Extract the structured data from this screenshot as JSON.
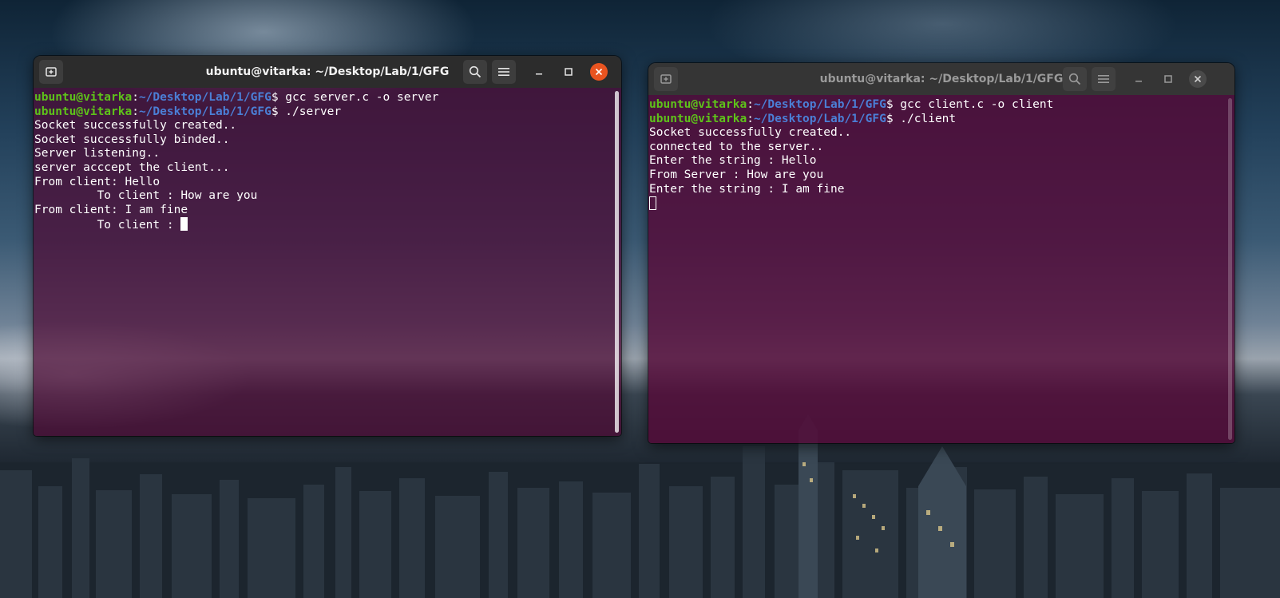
{
  "desktop": {
    "wallpaper": "night-city-skyline",
    "accent_close": "#e95420",
    "terminal_bg": "#5a0b3c"
  },
  "server_window": {
    "title": "ubuntu@vitarka: ~/Desktop/Lab/1/GFG",
    "state": "focused",
    "icons": [
      "new-tab-icon",
      "search-icon",
      "hamburger-menu-icon",
      "minimize-icon",
      "maximize-icon",
      "close-icon"
    ],
    "prompt_user": "ubuntu@vitarka",
    "prompt_sep": ":",
    "prompt_path": "~/Desktop/Lab/1/GFG",
    "prompt_end": "$ ",
    "commands": [
      "gcc server.c -o server",
      "./server"
    ],
    "output": [
      "Socket successfully created..",
      "Socket successfully binded..",
      "Server listening..",
      "server acccept the client...",
      "From client: Hello",
      "         To client : How are you",
      "From client: I am fine",
      "         To client : "
    ]
  },
  "client_window": {
    "title": "ubuntu@vitarka: ~/Desktop/Lab/1/GFG",
    "state": "unfocused",
    "icons": [
      "new-tab-icon",
      "search-icon",
      "hamburger-menu-icon",
      "minimize-icon",
      "maximize-icon",
      "close-icon"
    ],
    "prompt_user": "ubuntu@vitarka",
    "prompt_sep": ":",
    "prompt_path": "~/Desktop/Lab/1/GFG",
    "prompt_end": "$ ",
    "commands": [
      "gcc client.c -o client",
      "./client"
    ],
    "output": [
      "Socket successfully created..",
      "connected to the server..",
      "Enter the string : Hello",
      "From Server : How are you",
      "Enter the string : I am fine"
    ]
  }
}
